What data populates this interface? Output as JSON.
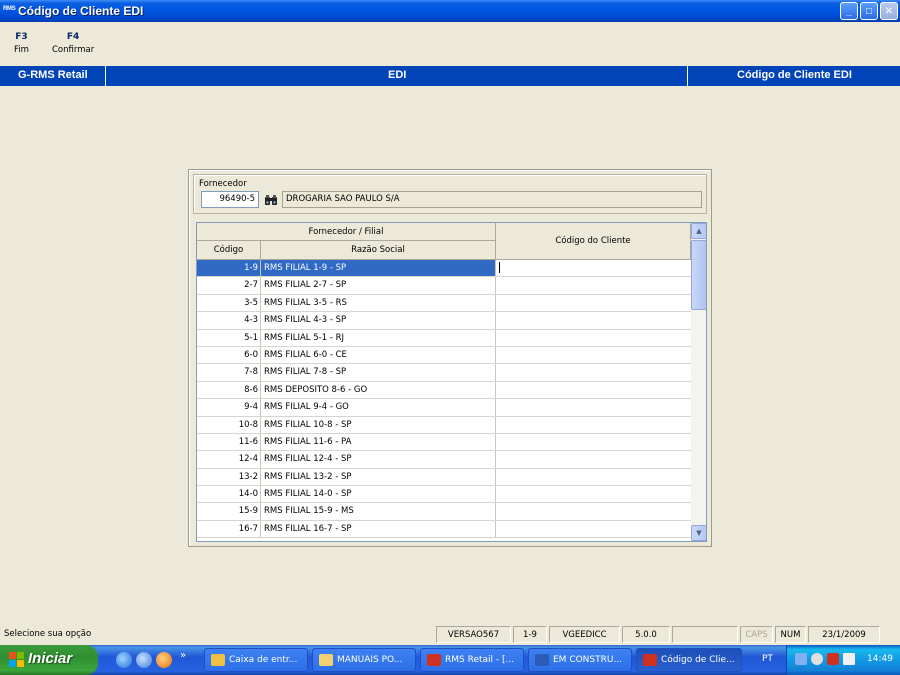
{
  "window": {
    "logo": "RMS",
    "title": "Código de Cliente EDI",
    "controls": {
      "minimize": "_",
      "maximize": "□",
      "close": "✕"
    }
  },
  "toolbar": {
    "keys": [
      {
        "key": "F3",
        "label": "Fim"
      },
      {
        "key": "F4",
        "label": "Confirmar"
      }
    ]
  },
  "band": {
    "left": "G-RMS Retail",
    "center": "EDI",
    "right": "Código de Cliente EDI"
  },
  "form": {
    "supplier_label": "Fornecedor",
    "supplier_code": "96490-5",
    "supplier_name": "DROGARIA SAO PAULO S/A"
  },
  "grid": {
    "group_header": "Fornecedor / Filial",
    "col_code": "Código",
    "col_name": "Razão Social",
    "col_client": "Código do Cliente",
    "rows": [
      {
        "code": "1-9",
        "name": "RMS FILIAL 1-9 - SP",
        "client": ""
      },
      {
        "code": "2-7",
        "name": "RMS FILIAL 2-7 - SP",
        "client": ""
      },
      {
        "code": "3-5",
        "name": "RMS FILIAL 3-5 - RS",
        "client": ""
      },
      {
        "code": "4-3",
        "name": "RMS FILIAL 4-3 - SP",
        "client": ""
      },
      {
        "code": "5-1",
        "name": "RMS FILIAL 5-1 - RJ",
        "client": ""
      },
      {
        "code": "6-0",
        "name": "RMS FILIAL 6-0 - CE",
        "client": ""
      },
      {
        "code": "7-8",
        "name": "RMS FILIAL 7-8 - SP",
        "client": ""
      },
      {
        "code": "8-6",
        "name": "RMS DEPOSITO 8-6 - GO",
        "client": ""
      },
      {
        "code": "9-4",
        "name": "RMS FILIAL 9-4 - GO",
        "client": ""
      },
      {
        "code": "10-8",
        "name": "RMS FILIAL 10-8 - SP",
        "client": ""
      },
      {
        "code": "11-6",
        "name": "RMS FILIAL 11-6 - PA",
        "client": ""
      },
      {
        "code": "12-4",
        "name": "RMS FILIAL 12-4 - SP",
        "client": ""
      },
      {
        "code": "13-2",
        "name": "RMS FILIAL 13-2 - SP",
        "client": ""
      },
      {
        "code": "14-0",
        "name": "RMS FILIAL 14-0 - SP",
        "client": ""
      },
      {
        "code": "15-9",
        "name": "RMS FILIAL 15-9 - MS",
        "client": ""
      },
      {
        "code": "16-7",
        "name": "RMS FILIAL 16-7 - SP",
        "client": ""
      }
    ],
    "scroll_up": "▲",
    "scroll_down": "▼"
  },
  "status": {
    "message": "Selecione sua opção",
    "version": "VERSAO567",
    "filial": "1-9",
    "program": "VGEEDICC",
    "release": "5.0.0",
    "blank": "",
    "caps": "CAPS",
    "num": "NUM",
    "date": "23/1/2009"
  },
  "taskbar": {
    "start": "Iniciar",
    "quick_more": "»",
    "tasks": [
      {
        "label": "Caixa de entr...",
        "icon_color": "#F0C040"
      },
      {
        "label": "MANUAIS PO...",
        "icon_color": "#F4D070"
      },
      {
        "label": "RMS Retail - [...",
        "icon_color": "#D03020"
      },
      {
        "label": "EM CONSTRU...",
        "icon_color": "#2A5CB8"
      },
      {
        "label": "Código de Clie...",
        "icon_color": "#D03020"
      }
    ],
    "lang": "PT",
    "clock": "14:49"
  }
}
